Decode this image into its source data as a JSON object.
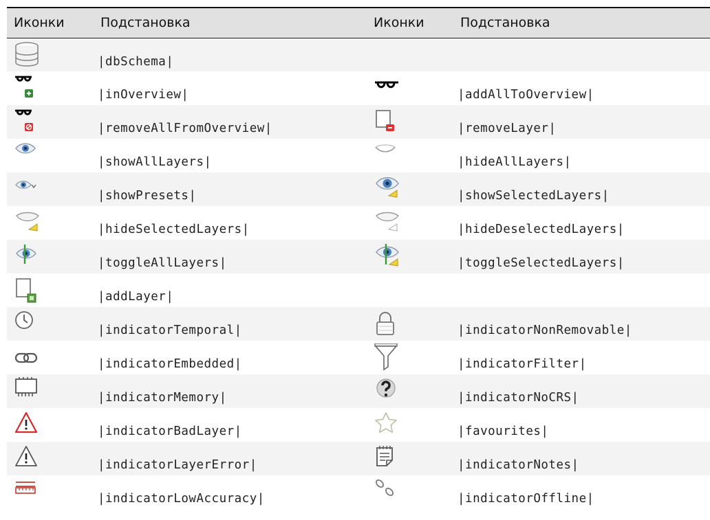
{
  "table": {
    "headers": {
      "icons": "Иконки",
      "substitution": "Подстановка"
    },
    "rows": [
      {
        "left_icon": "database-schema-icon",
        "left_sub": "|dbSchema|",
        "right_icon": "",
        "right_sub": ""
      },
      {
        "left_icon": "glasses-plus-icon",
        "left_sub": "|inOverview|",
        "right_icon": "glasses-icon",
        "right_sub": "|addAllToOverview|"
      },
      {
        "left_icon": "glasses-remove-icon",
        "left_sub": "|removeAllFromOverview|",
        "right_icon": "remove-layer-icon",
        "right_sub": "|removeLayer|"
      },
      {
        "left_icon": "eye-open-icon",
        "left_sub": "|showAllLayers|",
        "right_icon": "eye-closed-icon",
        "right_sub": "|hideAllLayers|"
      },
      {
        "left_icon": "eye-presets-icon",
        "left_sub": "|showPresets|",
        "right_icon": "eye-selected-icon",
        "right_sub": "|showSelectedLayers|"
      },
      {
        "left_icon": "eye-closed-selected-icon",
        "left_sub": "|hideSelectedLayers|",
        "right_icon": "eye-closed-deselected-icon",
        "right_sub": "|hideDeselectedLayers|"
      },
      {
        "left_icon": "eye-toggle-icon",
        "left_sub": "|toggleAllLayers|",
        "right_icon": "eye-toggle-selected-icon",
        "right_sub": "|toggleSelectedLayers|"
      },
      {
        "left_icon": "add-layer-icon",
        "left_sub": "|addLayer|",
        "right_icon": "",
        "right_sub": ""
      },
      {
        "left_icon": "clock-icon",
        "left_sub": "|indicatorTemporal|",
        "right_icon": "lock-icon",
        "right_sub": "|indicatorNonRemovable|"
      },
      {
        "left_icon": "chain-link-icon",
        "left_sub": "|indicatorEmbedded|",
        "right_icon": "funnel-filter-icon",
        "right_sub": "|indicatorFilter|"
      },
      {
        "left_icon": "memory-chip-icon",
        "left_sub": "|indicatorMemory|",
        "right_icon": "question-crs-icon",
        "right_sub": "|indicatorNoCRS|"
      },
      {
        "left_icon": "warning-red-icon",
        "left_sub": "|indicatorBadLayer|",
        "right_icon": "star-outline-icon",
        "right_sub": "|favourites|"
      },
      {
        "left_icon": "warning-gray-icon",
        "left_sub": "|indicatorLayerError|",
        "right_icon": "notes-icon",
        "right_sub": "|indicatorNotes|"
      },
      {
        "left_icon": "ruler-icon",
        "left_sub": "|indicatorLowAccuracy|",
        "right_icon": "broken-link-icon",
        "right_sub": "|indicatorOffline|"
      }
    ]
  }
}
